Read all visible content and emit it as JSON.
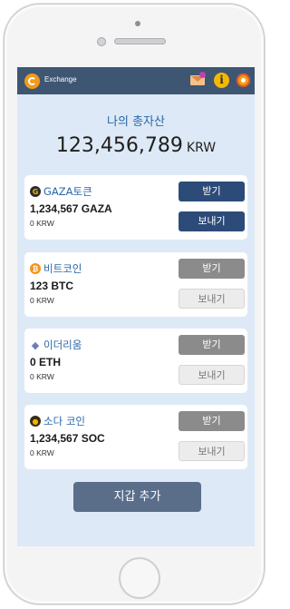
{
  "app": {
    "name": "Exchange"
  },
  "header": {
    "title": "나의 총자산",
    "total_value": "123,456,789",
    "total_unit": "KRW"
  },
  "wallets": [
    {
      "name": "GAZA토큰",
      "amount": "1,234,567 GAZA",
      "krw": "0 KRW",
      "icon_glyph": "G",
      "icon_color": "#2b2b2b",
      "receive_label": "받기",
      "send_label": "보내기"
    },
    {
      "name": "비트코인",
      "amount": "123 BTC",
      "krw": "0 KRW",
      "icon_glyph": "₿",
      "icon_color": "#f7931a",
      "receive_label": "받기",
      "send_label": "보내기"
    },
    {
      "name": "이더리움",
      "amount": "0 ETH",
      "krw": "0 KRW",
      "icon_glyph": "◆",
      "icon_color": "#6d7fb8",
      "receive_label": "받기",
      "send_label": "보내기"
    },
    {
      "name": "소다 코인",
      "amount": "1,234,567 SOC",
      "krw": "0 KRW",
      "icon_glyph": "●",
      "icon_color": "#3a2a10",
      "receive_label": "받기",
      "send_label": "보내기"
    }
  ],
  "footer": {
    "add_wallet_label": "지갑 추가"
  },
  "icons": {
    "logo": "exchange-logo-icon",
    "mail": "mail-notification-icon",
    "info": "info-icon",
    "settings": "gear-icon"
  },
  "colors": {
    "topbar": "#3e5672",
    "accent": "#2a66a8",
    "active_button": "#2c4b78",
    "background": "#dde9f6"
  }
}
